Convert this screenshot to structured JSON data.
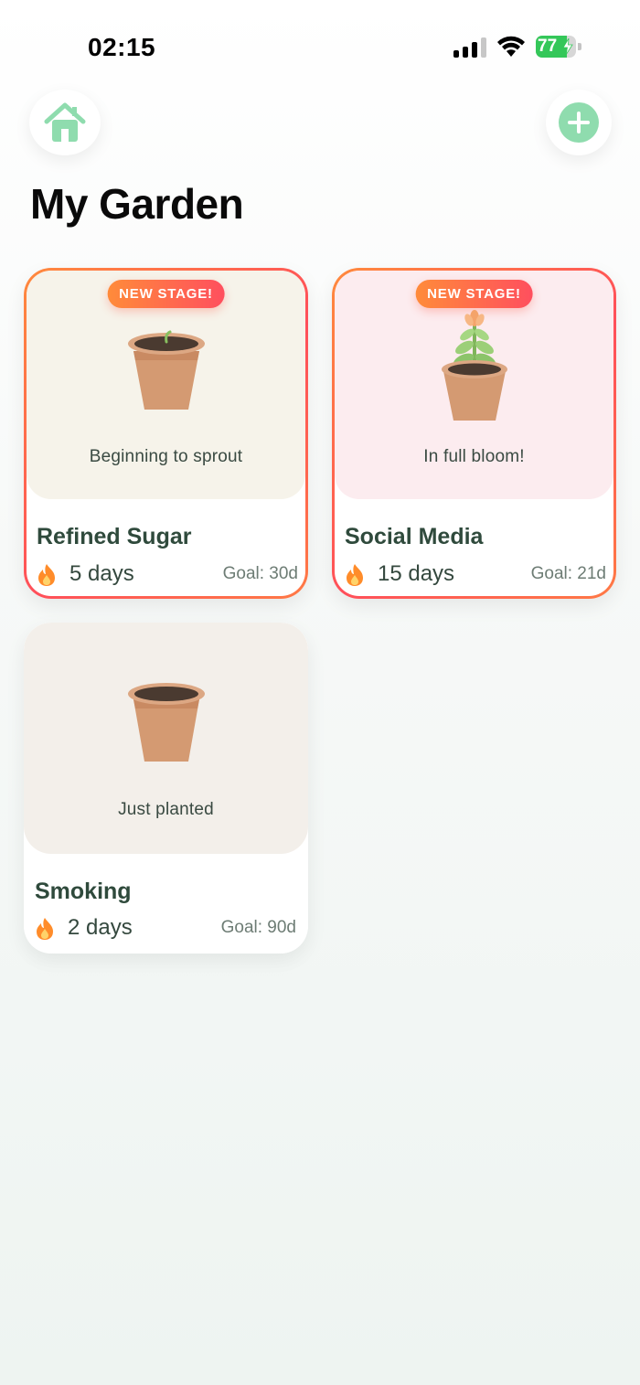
{
  "status_bar": {
    "time": "02:15",
    "battery_percent": "77",
    "battery_level": 0.77,
    "signal_bars": 3,
    "charging": true,
    "icons": [
      "cellular-signal-icon",
      "wifi-icon",
      "battery-icon"
    ]
  },
  "header": {
    "home_icon": "house-icon",
    "add_icon": "plus-icon",
    "title": "My Garden"
  },
  "colors": {
    "accent_green": "#8fdcae",
    "badge_gradient": [
      "#ff8b3a",
      "#ff4f5e"
    ],
    "flame": "#ff8c2a"
  },
  "habits": [
    {
      "name": "Refined Sugar",
      "stage_label": "Beginning to sprout",
      "badge": "NEW STAGE!",
      "streak": "5 days",
      "goal": "Goal: 30d",
      "plant": "sprout",
      "card_bg": "#f6f3ea"
    },
    {
      "name": "Social Media",
      "stage_label": "In full bloom!",
      "badge": "NEW STAGE!",
      "streak": "15 days",
      "goal": "Goal: 21d",
      "plant": "bloom",
      "card_bg": "#fcecef"
    },
    {
      "name": "Smoking",
      "stage_label": "Just planted",
      "badge": "",
      "streak": "2 days",
      "goal": "Goal: 90d",
      "plant": "empty",
      "card_bg": "#f3efea"
    }
  ]
}
